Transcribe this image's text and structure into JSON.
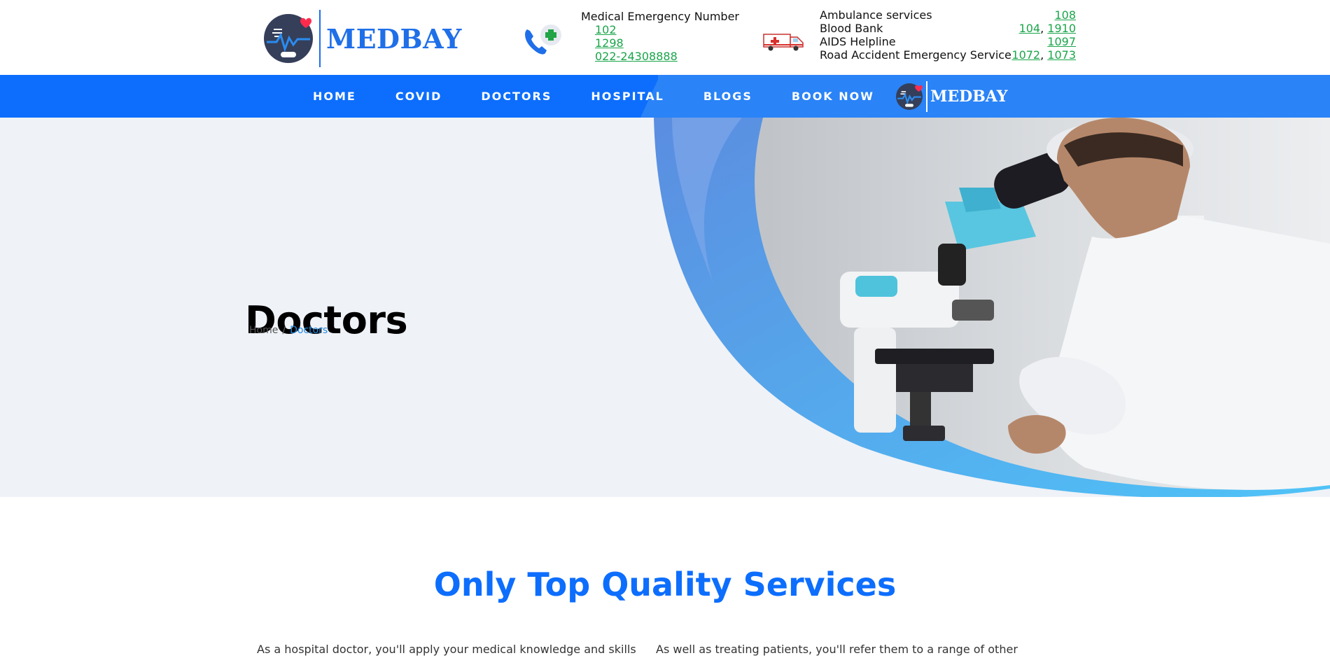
{
  "brand": {
    "name": "MEDBAY"
  },
  "colors": {
    "primary": "#0d6efd",
    "link_green": "#1aa54a",
    "hero_bg": "#eff2f7"
  },
  "emergency": {
    "title": "Medical Emergency Number",
    "numbers": [
      "102",
      "1298",
      "022-24308888"
    ]
  },
  "services": [
    {
      "label": "Ambulance services",
      "numbers": [
        "108"
      ]
    },
    {
      "label": "Blood Bank",
      "numbers": [
        "104",
        "1910"
      ]
    },
    {
      "label": "AIDS Helpline",
      "numbers": [
        "1097"
      ]
    },
    {
      "label": "Road Accident Emergency Service",
      "numbers": [
        "1072",
        "1073"
      ]
    }
  ],
  "nav": {
    "items": [
      "HOME",
      "COVID",
      "DOCTORS",
      "HOSPITAL",
      "BLOGS",
      "BOOK NOW"
    ]
  },
  "hero": {
    "title": "Doctors",
    "breadcrumb": {
      "home": "Home",
      "separator": "/",
      "current": "Doctors"
    }
  },
  "section": {
    "title": "Only Top Quality Services",
    "intro_left": "As a hospital doctor, you'll apply your medical knowledge and skills",
    "intro_right": "As well as treating patients, you'll refer them to a range of other"
  },
  "icons": [
    "logo-heart-monitor-icon",
    "phone-plus-icon",
    "ambulance-icon"
  ]
}
